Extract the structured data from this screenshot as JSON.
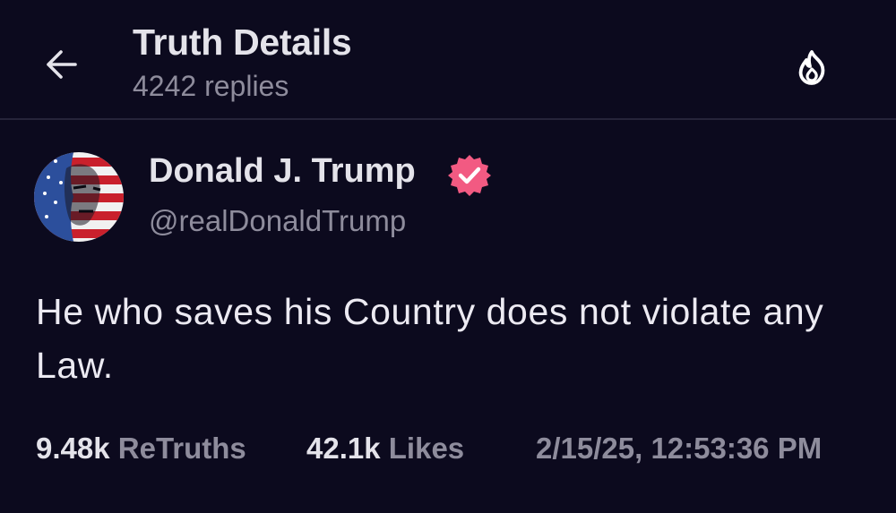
{
  "header": {
    "title": "Truth Details",
    "subtitle": "4242 replies",
    "back_icon": "arrow-left-icon",
    "action_icon": "fire-icon"
  },
  "post": {
    "author_name": "Donald J. Trump",
    "author_handle": "@realDonaldTrump",
    "verified": true,
    "text": "He who saves his Country does not violate any Law.",
    "stats": {
      "retruths_count": "9.48k",
      "retruths_label": "ReTruths",
      "likes_count": "42.1k",
      "likes_label": "Likes"
    },
    "timestamp": "2/15/25, 12:53:36 PM"
  },
  "colors": {
    "background": "#0c0a1e",
    "primary_text": "#e4e3ea",
    "secondary_text": "#8e8c9c",
    "verified_badge": "#f25a82",
    "divider": "#26243a"
  }
}
